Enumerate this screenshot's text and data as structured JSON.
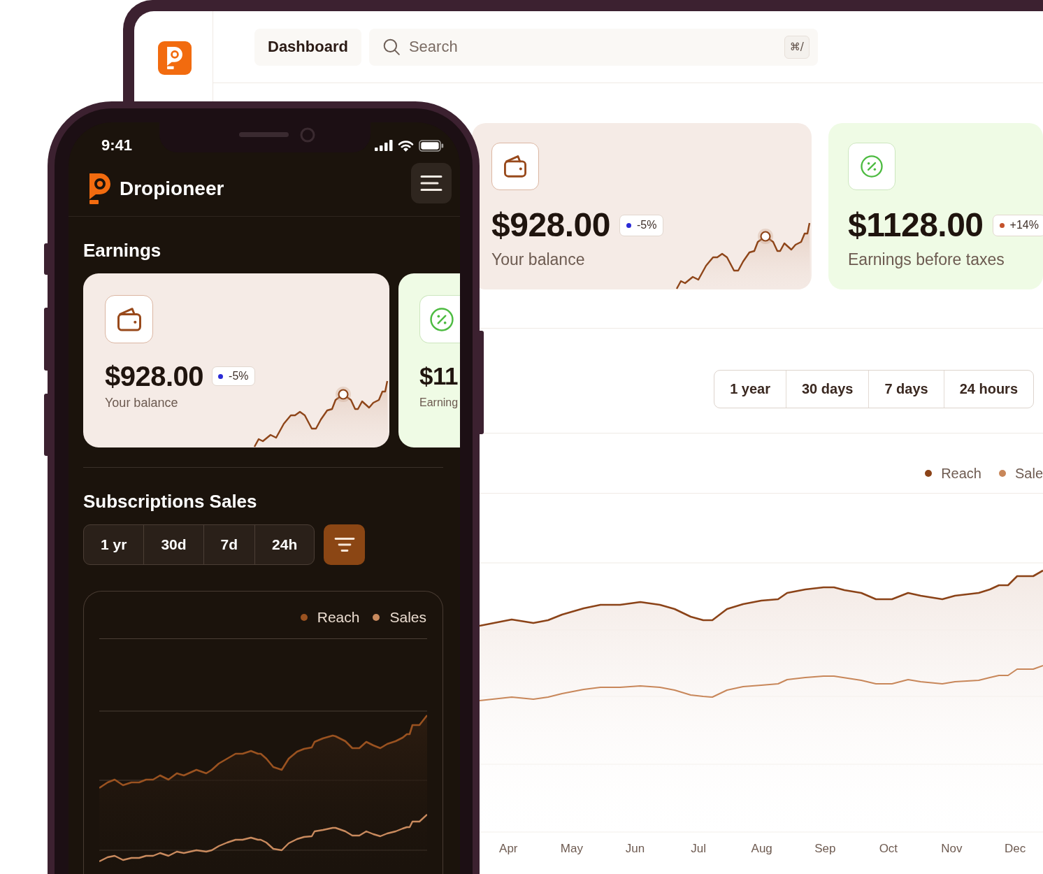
{
  "desktop": {
    "top_bar": {
      "page_tab": "Dashboard",
      "search": {
        "placeholder": "Search",
        "shortcut": "⌘/"
      }
    },
    "cards": [
      {
        "kind": "wallet",
        "amount": "$928.00",
        "change": {
          "text": "-5%",
          "color": "#2b2bd6"
        },
        "label": "Your balance"
      },
      {
        "kind": "percent",
        "amount": "$1128.00",
        "change": {
          "text": "+14%",
          "color": "#c4522b"
        },
        "label": "Earnings before taxes"
      }
    ],
    "ranges": [
      "1 year",
      "30 days",
      "7 days",
      "24 hours"
    ],
    "chart": {
      "legend": [
        {
          "label": "Reach",
          "color": "#8b4318"
        },
        {
          "label": "Sale",
          "color": "#c8875a"
        }
      ],
      "x_labels": [
        "Apr",
        "May",
        "Jun",
        "Jul",
        "Aug",
        "Sep",
        "Oct",
        "Nov",
        "Dec"
      ]
    }
  },
  "phone": {
    "status_bar": {
      "time": "9:41"
    },
    "app_name": "Dropioneer",
    "earnings": {
      "title": "Earnings",
      "cards": [
        {
          "kind": "wallet",
          "amount": "$928.00",
          "change": {
            "text": "-5%",
            "color": "#2b2bd6"
          },
          "label": "Your balance"
        },
        {
          "kind": "percent",
          "amount": "$11",
          "label": "Earning"
        }
      ]
    },
    "sales": {
      "title": "Subscriptions Sales",
      "ranges": [
        "1 yr",
        "30d",
        "7d",
        "24h"
      ],
      "chart": {
        "legend": [
          {
            "label": "Reach",
            "color": "#9a5220"
          },
          {
            "label": "Sales",
            "color": "#c98a5e"
          }
        ]
      }
    }
  }
}
